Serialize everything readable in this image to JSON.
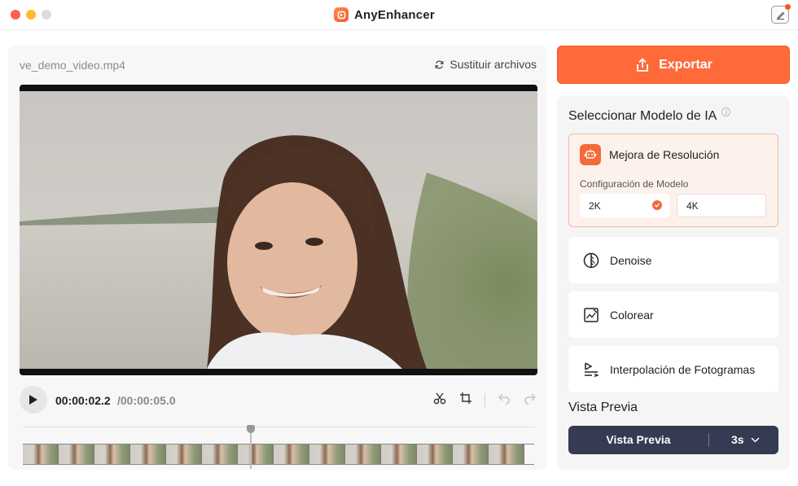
{
  "window": {
    "app_name": "AnyEnhancer"
  },
  "editor": {
    "file_name": "ve_demo_video.mp4",
    "replace_label": "Sustituir archivos",
    "current_time": "00:00:02.2",
    "total_time": "/00:00:05.0",
    "filmstrip_frames": 14
  },
  "sidebar": {
    "export_label": "Exportar",
    "model_section_title": "Seleccionar Modelo de IA",
    "models": [
      {
        "label": "Mejora de Resolución",
        "icon": "robot-icon",
        "selected": true
      },
      {
        "label": "Denoise",
        "icon": "denoise-icon",
        "selected": false
      },
      {
        "label": "Colorear",
        "icon": "colorize-icon",
        "selected": false
      },
      {
        "label": "Interpolación de Fotogramas",
        "icon": "frame-interpolation-icon",
        "selected": false
      }
    ],
    "model_config_label": "Configuración de Modelo",
    "resolution_options": [
      {
        "label": "2K",
        "selected": true
      },
      {
        "label": "4K",
        "selected": false
      }
    ],
    "preview_section_title": "Vista Previa",
    "preview_button_label": "Vista Previa",
    "preview_duration": "3s"
  },
  "colors": {
    "accent": "#ff6a3a",
    "selected_card_bg": "#fdf1ec",
    "preview_button_bg": "#343b52"
  }
}
